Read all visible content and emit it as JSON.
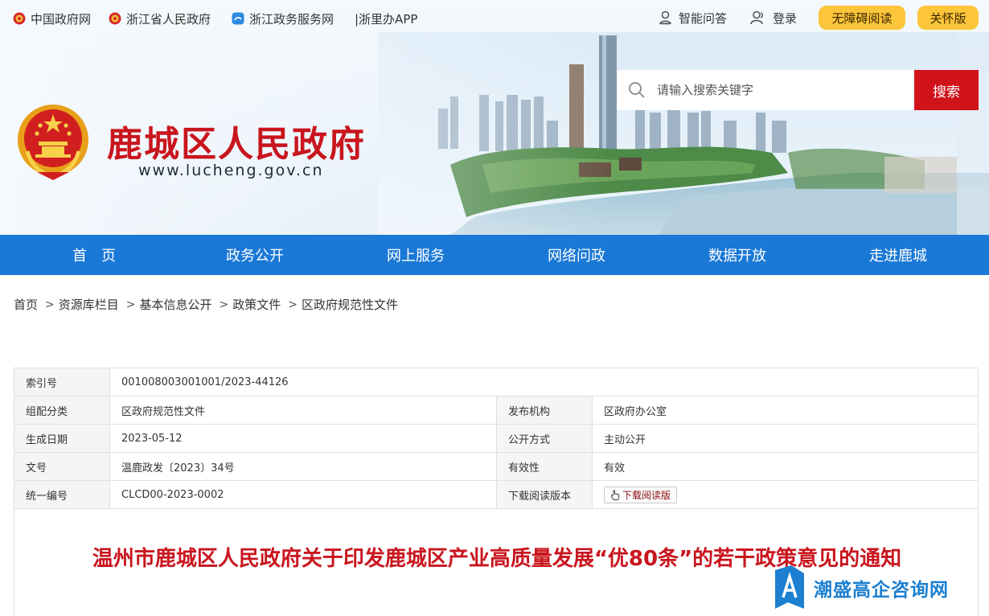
{
  "topbar": {
    "links": [
      {
        "label": "中国政府网",
        "icon": "national-emblem-icon"
      },
      {
        "label": "浙江省人民政府",
        "icon": "national-emblem-icon"
      },
      {
        "label": "浙江政务服务网",
        "icon": "zj-service-icon"
      },
      {
        "label": "|浙里办APP"
      }
    ],
    "qa_label": "智能问答",
    "login_label": "登录",
    "accessibility_label": "无障碍阅读",
    "care_label": "关怀版"
  },
  "header": {
    "title": "鹿城区人民政府",
    "url": "www.lucheng.gov.cn",
    "search_placeholder": "请输入搜索关键字",
    "search_button": "搜索"
  },
  "nav": {
    "items": [
      "首　页",
      "政务公开",
      "网上服务",
      "网络问政",
      "数据开放",
      "走进鹿城"
    ]
  },
  "breadcrumb": [
    "首页",
    "资源库栏目",
    "基本信息公开",
    "政策文件",
    "区政府规范性文件"
  ],
  "breadcrumb_sep": ">",
  "info": {
    "index_key": "索引号",
    "index_val": "001008003001001/2023-44126",
    "rows": [
      {
        "k1": "组配分类",
        "v1": "区政府规范性文件",
        "k2": "发布机构",
        "v2": "区政府办公室"
      },
      {
        "k1": "生成日期",
        "v1": "2023-05-12",
        "k2": "公开方式",
        "v2": "主动公开"
      },
      {
        "k1": "文号",
        "v1": "温鹿政发〔2023〕34号",
        "k2": "有效性",
        "v2": "有效"
      }
    ],
    "serial_key": "统一编号",
    "serial_val": "CLCD00-2023-0002",
    "download_key": "下载阅读版本",
    "download_button": "下载阅读版"
  },
  "article": {
    "title": "温州市鹿城区人民政府关于印发鹿城区产业高质量发展“优80条”的若干政策意见的通知"
  },
  "watermark": {
    "text": "潮盛高企咨询网"
  },
  "colors": {
    "brand_red": "#c9151e",
    "nav_blue": "#1a78d6",
    "pill_yellow": "#fcc53a",
    "search_red": "#d0121b"
  }
}
